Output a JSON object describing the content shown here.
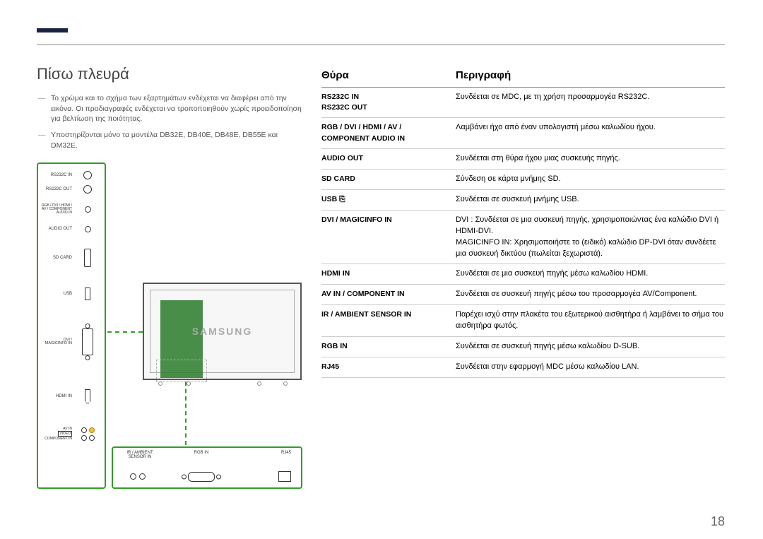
{
  "page_number": "18",
  "heading": "Πίσω πλευρά",
  "notes": {
    "a": "Το χρώμα και το σχήμα των εξαρτημάτων ενδέχεται να διαφέρει από την εικόνα. Οι προδιαγραφές ενδέχεται να τροποποιηθούν χωρίς προειδοποίηση για βελτίωση της ποιότητας.",
    "b": "Υποστηρίζονται μόνο τα μοντέλα DB32E, DB40E, DB48E, DB55E και DM32E."
  },
  "monitor_logo": "SAMSUNG",
  "side_panel_labels": {
    "rs232c_in": "RS232C IN",
    "rs232c_out": "RS232C OUT",
    "audio_in": "RGB / DVI / HDMI / AV / COMPONENT AUDIO IN",
    "audio_out": "AUDIO OUT",
    "sd_card": "SD CARD",
    "usb": "USB",
    "dvi": "DVI / MAGICINFO IN",
    "hdmi": "HDMI IN",
    "av_in": "AV IN",
    "video": "VIDEO",
    "component_in": "COMPONENT IN"
  },
  "bottom_panel_labels": {
    "sensor": "IR / AMBIENT SENSOR IN",
    "rgb_in": "RGB IN",
    "rj45": "RJ45"
  },
  "table": {
    "h_port": "Θύρα",
    "h_desc": "Περιγραφή",
    "rows": [
      {
        "port": "RS232C IN\nRS232C OUT",
        "desc": "Συνδέεται σε MDC, με τη χρήση προσαρμογέα RS232C."
      },
      {
        "port": "RGB / DVI / HDMI / AV / COMPONENT AUDIO IN",
        "desc": "Λαμβάνει ήχο από έναν υπολογιστή μέσω καλωδίου ήχου."
      },
      {
        "port": "AUDIO OUT",
        "desc": "Συνδέεται στη θύρα ήχου μιας συσκευής πηγής."
      },
      {
        "port": "SD CARD",
        "desc": "Σύνδεση σε κάρτα μνήμης SD."
      },
      {
        "port": "USB ⎘",
        "desc": "Συνδέεται σε συσκευή μνήμης USB."
      },
      {
        "port": "DVI / MAGICINFO IN",
        "desc": "DVI : Συνδέεται σε μια συσκευή πηγής, χρησιμοποιώντας ένα καλώδιο DVI ή HDMI-DVI.\nMAGICINFO IN: Χρησιμοποιήστε το (ειδικό) καλώδιο DP-DVI όταν συνδέετε μια συσκευή δικτύου (πωλείται ξεχωριστά)."
      },
      {
        "port": "HDMI IN",
        "desc": "Συνδέεται σε μια συσκευή πηγής μέσω καλωδίου HDMI."
      },
      {
        "port": "AV IN / COMPONENT IN",
        "desc": "Συνδέεται σε συσκευή πηγής μέσω του προσαρμογέα AV/Component."
      },
      {
        "port": "IR / AMBIENT SENSOR IN",
        "desc": "Παρέχει ισχύ στην πλακέτα του εξωτερικού αισθητήρα ή λαμβάνει το σήμα του αισθητήρα φωτός."
      },
      {
        "port": "RGB IN",
        "desc": "Συνδέεται σε συσκευή πηγής μέσω καλωδίου D-SUB."
      },
      {
        "port": "RJ45",
        "desc": "Συνδέεται στην εφαρμογή MDC μέσω καλωδίου LAN."
      }
    ]
  }
}
